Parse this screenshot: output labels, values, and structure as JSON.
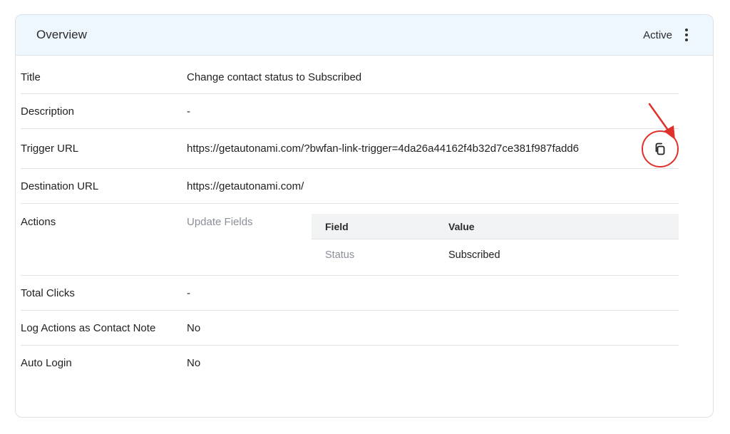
{
  "header": {
    "title": "Overview",
    "status": "Active"
  },
  "rows": {
    "title": {
      "label": "Title",
      "value": "Change contact status to Subscribed"
    },
    "description": {
      "label": "Description",
      "value": "-"
    },
    "trigger_url": {
      "label": "Trigger URL",
      "value": "https://getautonami.com/?bwfan-link-trigger=4da26a44162f4b32d7ce381f987fadd6"
    },
    "destination_url": {
      "label": "Destination URL",
      "value": "https://getautonami.com/"
    },
    "actions": {
      "label": "Actions",
      "action_name": "Update Fields",
      "table": {
        "headers": [
          "Field",
          "Value"
        ],
        "rows": [
          [
            "Status",
            "Subscribed"
          ]
        ]
      }
    },
    "total_clicks": {
      "label": "Total Clicks",
      "value": "-"
    },
    "log_actions": {
      "label": "Log Actions as Contact Note",
      "value": "No"
    },
    "auto_login": {
      "label": "Auto Login",
      "value": "No"
    }
  },
  "icons": {
    "copy": "copy-icon",
    "menu": "kebab-menu-icon",
    "annotation": "red-arrow-annotation"
  },
  "colors": {
    "header_bg": "#eef6fe",
    "annotation_red": "#e0302a"
  }
}
